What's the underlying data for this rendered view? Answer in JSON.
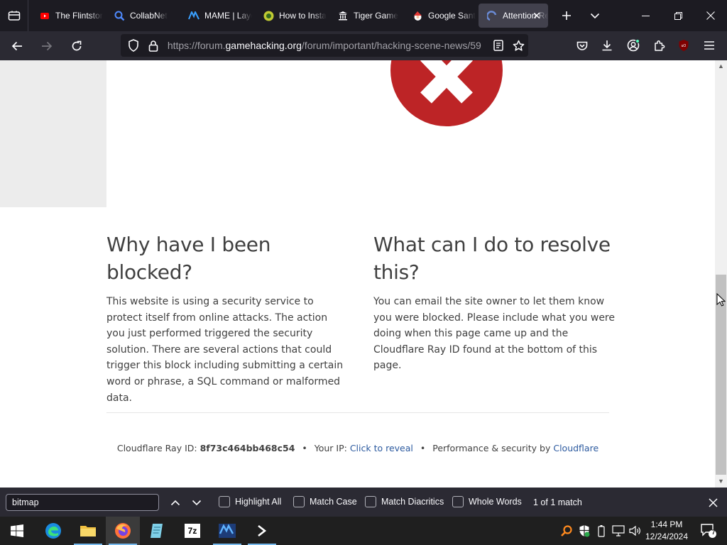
{
  "browser": {
    "tabs": [
      {
        "label": "The Flintstones",
        "favicon": "youtube-icon",
        "color": "#ff0000",
        "active": false
      },
      {
        "label": "CollabNet",
        "favicon": "search-icon",
        "color": "#4f8bff",
        "active": false
      },
      {
        "label": "MAME | Layout",
        "favicon": "mame-icon",
        "color": "#3aa0ff",
        "active": false
      },
      {
        "label": "How to Install",
        "favicon": "site-icon",
        "color": "#8bc34a",
        "active": false
      },
      {
        "label": "Tiger Game",
        "favicon": "museum-icon",
        "color": "#ffffff",
        "active": false
      },
      {
        "label": "Google Santa",
        "favicon": "santa-icon",
        "color": "#e53935",
        "active": false
      },
      {
        "label": "Attention Required!",
        "favicon": "cloudflare-icon",
        "color": "#6a8bd6",
        "active": true
      }
    ],
    "url": {
      "prefix": "https://forum.",
      "host": "gamehacking.org",
      "path": "/forum/important/hacking-scene-news/59"
    }
  },
  "page": {
    "why_title": "Why have I been blocked?",
    "why_body": "This website is using a security service to protect itself from online attacks. The action you just performed triggered the security solution. There are several actions that could trigger this block including submitting a certain word or phrase, a SQL command or malformed data.",
    "what_title": "What can I do to resolve this?",
    "what_body": "You can email the site owner to let them know you were blocked. Please include what you were doing when this page came up and the Cloudflare Ray ID found at the bottom of this page.",
    "footer": {
      "ray_label": "Cloudflare Ray ID:",
      "ray_id": "8f73c464bb468c54",
      "ip_label": "Your IP:",
      "ip_link": "Click to reveal",
      "perf_label": "Performance & security by",
      "perf_link": "Cloudflare",
      "bullet": "•"
    },
    "error_color": "#bd2426"
  },
  "findbar": {
    "query": "bitmap",
    "options": [
      "Highlight All",
      "Match Case",
      "Match Diacritics",
      "Whole Words"
    ],
    "status": "1 of 1 match"
  },
  "taskbar": {
    "time": "1:44 PM",
    "date": "12/24/2024",
    "notification_count": "7",
    "app_7zip_label": "7z"
  }
}
